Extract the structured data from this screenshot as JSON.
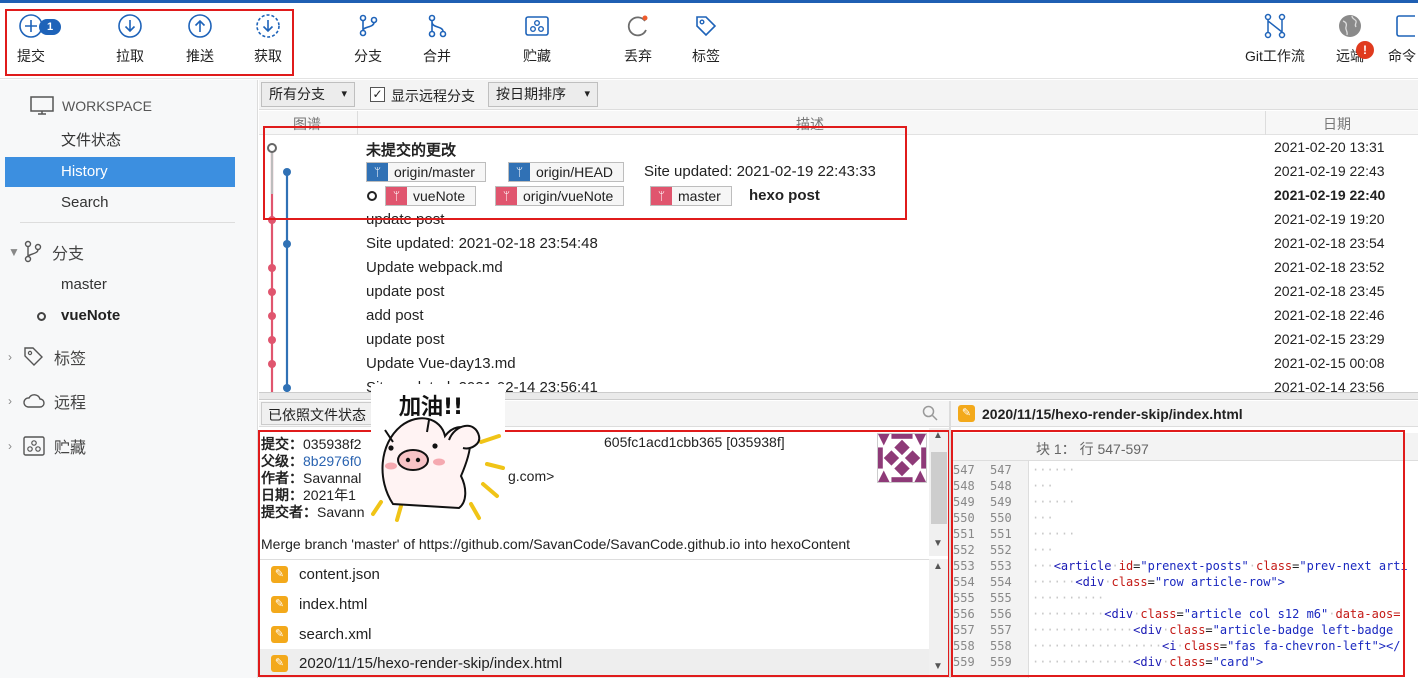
{
  "toolbar": {
    "commit": {
      "label": "提交",
      "badge": "1"
    },
    "pull": "拉取",
    "push": "推送",
    "fetch": "获取",
    "branch": "分支",
    "merge": "合并",
    "stash": "贮藏",
    "discard": "丢弃",
    "tag": "标签",
    "gitflow": "Git工作流",
    "remote": {
      "label": "远端",
      "alert": "!"
    },
    "terminal": "命令"
  },
  "sidebar": {
    "workspace": "WORKSPACE",
    "ws_items": [
      "文件状态",
      "History",
      "Search"
    ],
    "branches_title": "分支",
    "branches": [
      "master",
      "vueNote"
    ],
    "tags_title": "标签",
    "remotes_title": "远程",
    "stashes_title": "贮藏"
  },
  "filter": {
    "branches": "所有分支",
    "show_remote": "显示远程分支",
    "show_remote_checked": "✓",
    "sort": "按日期排序"
  },
  "columns": {
    "graph": "图谱",
    "desc": "描述",
    "date": "日期"
  },
  "commits": [
    {
      "msg": "未提交的更改",
      "date": "2021-02-20 13:31"
    },
    {
      "msg": "Site updated: 2021-02-19 22:43:33",
      "date": "2021-02-19 22:43"
    },
    {
      "msg": "hexo post",
      "date": "2021-02-19 22:40"
    },
    {
      "msg": "update post",
      "date": "2021-02-19 19:20"
    },
    {
      "msg": "Site updated: 2021-02-18 23:54:48",
      "date": "2021-02-18 23:54"
    },
    {
      "msg": "Update webpack.md",
      "date": "2021-02-18 23:52"
    },
    {
      "msg": "update  post",
      "date": "2021-02-18 23:45"
    },
    {
      "msg": "add post",
      "date": "2021-02-18 22:46"
    },
    {
      "msg": "update post",
      "date": "2021-02-15 23:29"
    },
    {
      "msg": "Update Vue-day13.md",
      "date": "2021-02-15 00:08"
    },
    {
      "msg": "Site updated: 2021-02-14 23:56:41",
      "date": "2021-02-14 23:56"
    }
  ],
  "refs": {
    "row1": [
      "origin/master",
      "origin/HEAD"
    ],
    "row2": [
      "vueNote",
      "origin/vueNote",
      "master"
    ]
  },
  "details_pane": {
    "selector": "已依照文件状态",
    "commit_label": "提交：",
    "commit_value": "035938f2",
    "commit_tail": "605fc1acd1cbb365 [035938f]",
    "parent_label": "父级：",
    "parent_value": "8b2976f0",
    "author_label": "作者：",
    "author_value": "Savannal",
    "author_tail": "g.com>",
    "date_label": "日期：",
    "date_value": "2021年1",
    "committer_label": "提交者：",
    "committer_value": "Savann",
    "message": "Merge branch 'master' of https://github.com/SavanCode/SavanCode.github.io into hexoContent"
  },
  "files": [
    "content.json",
    "index.html",
    "search.xml",
    "2020/11/15/hexo-render-skip/index.html"
  ],
  "sticker_text": "加油!!",
  "diff": {
    "file": "2020/11/15/hexo-render-skip/index.html",
    "hunk": "块 1： 行 547-597",
    "lines": [
      {
        "n": "547",
        "dots": "······",
        "code": ""
      },
      {
        "n": "548",
        "dots": "···",
        "code": ""
      },
      {
        "n": "549",
        "dots": "······",
        "code": ""
      },
      {
        "n": "550",
        "dots": "···",
        "code": ""
      },
      {
        "n": "551",
        "dots": "······",
        "code": ""
      },
      {
        "n": "552",
        "dots": "···",
        "code": ""
      },
      {
        "n": "553",
        "dots": "···",
        "tag": "<article",
        "rest": [
          [
            "id",
            "\"prenext-posts\""
          ],
          [
            "class",
            "\"prev-next arti"
          ]
        ]
      },
      {
        "n": "554",
        "dots": "······",
        "tag": "<div",
        "rest": [
          [
            "class",
            "\"row article-row\">"
          ]
        ]
      },
      {
        "n": "555",
        "dots": "··········",
        "code": ""
      },
      {
        "n": "556",
        "dots": "··········",
        "tag": "<div",
        "rest": [
          [
            "class",
            "\"article col s12 m6\""
          ],
          [
            "data-aos",
            ""
          ]
        ]
      },
      {
        "n": "557",
        "dots": "··············",
        "tag": "<div",
        "rest": [
          [
            "class",
            "\"article-badge left-badge"
          ]
        ]
      },
      {
        "n": "558",
        "dots": "··················",
        "tag": "<i",
        "rest": [
          [
            "class",
            "\"fas fa-chevron-left\"></"
          ]
        ]
      },
      {
        "n": "559",
        "dots": "··············",
        "tag": "<div",
        "rest": [
          [
            "class",
            "\"card\">"
          ]
        ]
      }
    ]
  },
  "colors": {
    "accent": "#3c8fe0",
    "branch_blue": "#3071b5",
    "branch_pink": "#e0556e",
    "highlight": "#e01b1b"
  }
}
